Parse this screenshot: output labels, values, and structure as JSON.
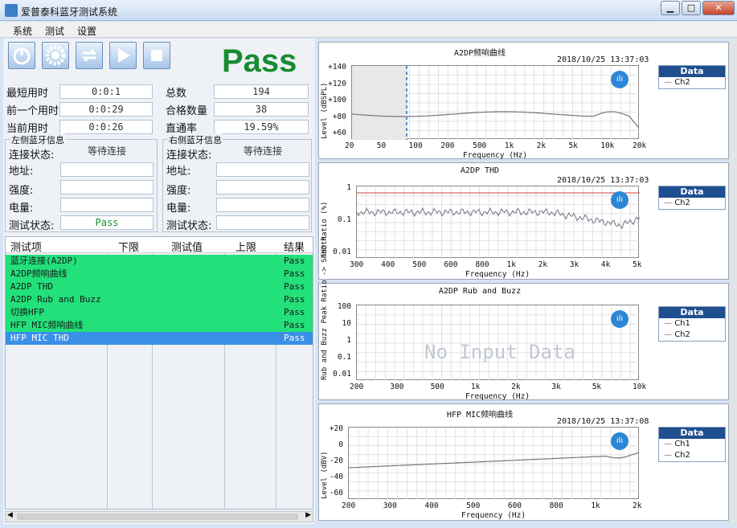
{
  "window": {
    "title": "爱普泰科蓝牙测试系统",
    "minimize": "▁",
    "maximize": "□",
    "close": "✕"
  },
  "menu": [
    "系统",
    "测试",
    "设置"
  ],
  "toolbar": {
    "icons": [
      "power-icon",
      "settings-gear-icon",
      "refresh-icon",
      "play-icon",
      "stop-icon"
    ]
  },
  "status": {
    "pass": "Pass"
  },
  "stats": {
    "shortest_label": "最短用时",
    "shortest": "0:0:1",
    "prev_label": "前一个用时",
    "prev": "0:0:29",
    "current_label": "当前用时",
    "current": "0:0:26",
    "total_label": "总数",
    "total": "194",
    "pass_count_label": "合格数量",
    "pass_count": "38",
    "yield_label": "直通率",
    "yield": "19.59%"
  },
  "left_bt": {
    "title": "左侧蓝牙信息",
    "conn_label": "连接状态:",
    "conn": "等待连接",
    "addr_label": "地址:",
    "strength_label": "强度:",
    "power_label": "电量:",
    "test_label": "测试状态:",
    "test": "Pass"
  },
  "right_bt": {
    "title": "右侧蓝牙信息",
    "conn_label": "连接状态:",
    "conn": "等待连接",
    "addr_label": "地址:",
    "strength_label": "强度:",
    "power_label": "电量:",
    "test_label": "测试状态:"
  },
  "table": {
    "headers": [
      "测试项",
      "下限",
      "测试值",
      "上限",
      "结果"
    ],
    "rows": [
      {
        "item": "蓝牙连接(A2DP)",
        "result": "Pass",
        "state": "pass"
      },
      {
        "item": "A2DP频响曲线",
        "result": "Pass",
        "state": "pass"
      },
      {
        "item": "A2DP THD",
        "result": "Pass",
        "state": "pass"
      },
      {
        "item": "A2DP Rub and Buzz",
        "result": "Pass",
        "state": "pass"
      },
      {
        "item": "切换HFP",
        "result": "Pass",
        "state": "pass"
      },
      {
        "item": "HFP MIC频响曲线",
        "result": "Pass",
        "state": "pass"
      },
      {
        "item": "HFP MIC THD",
        "result": "Pass",
        "state": "selected"
      }
    ]
  },
  "charts": [
    {
      "title": "A2DP频响曲线",
      "timestamp": "2018/10/25 13:37:03",
      "ylabel": "Level (dBSPL)",
      "yticks": [
        "+140",
        "+120",
        "+100",
        "+80",
        "+60"
      ],
      "xlabel": "Frequency (Hz)",
      "xticks": [
        "20",
        "50",
        "100",
        "200",
        "500",
        "1k",
        "2k",
        "5k",
        "10k",
        "20k"
      ],
      "legend_title": "Data",
      "legend": [
        "Ch2"
      ]
    },
    {
      "title": "A2DP THD",
      "timestamp": "2018/10/25 13:37:03",
      "ylabel": "THD Ratio (%)",
      "yticks": [
        "1",
        "0.1",
        "0.01"
      ],
      "xlabel": "Frequency (Hz)",
      "xticks": [
        "300",
        "400",
        "500",
        "600",
        "800",
        "1k",
        "2k",
        "3k",
        "4k",
        "5k"
      ],
      "legend_title": "Data",
      "legend": [
        "Ch2"
      ]
    },
    {
      "title": "A2DP Rub and Buzz",
      "timestamp": "",
      "ylabel": "Rub and Buzz Peak Ratio -> Smooth",
      "yticks": [
        "100",
        "10",
        "1",
        "0.1",
        "0.01"
      ],
      "xlabel": "Frequency (Hz)",
      "xticks": [
        "200",
        "300",
        "500",
        "1k",
        "2k",
        "3k",
        "5k",
        "10k"
      ],
      "legend_title": "Data",
      "legend": [
        "Ch1",
        "Ch2"
      ],
      "empty_text": "No Input Data"
    },
    {
      "title": "HFP MIC频响曲线",
      "timestamp": "2018/10/25 13:37:08",
      "ylabel": "Level (dBV)",
      "yticks": [
        "+20",
        "0",
        "-20",
        "-40",
        "-60"
      ],
      "xlabel": "Frequency (Hz)",
      "xticks": [
        "200",
        "300",
        "400",
        "500",
        "600",
        "800",
        "1k",
        "2k"
      ],
      "legend_title": "Data",
      "legend": [
        "Ch1",
        "Ch2"
      ]
    }
  ],
  "colors": {
    "pass_row": "#22e07a",
    "selected_row": "#3a8fe6",
    "pass_text": "#178c2f",
    "curve": "#7d6e83"
  }
}
